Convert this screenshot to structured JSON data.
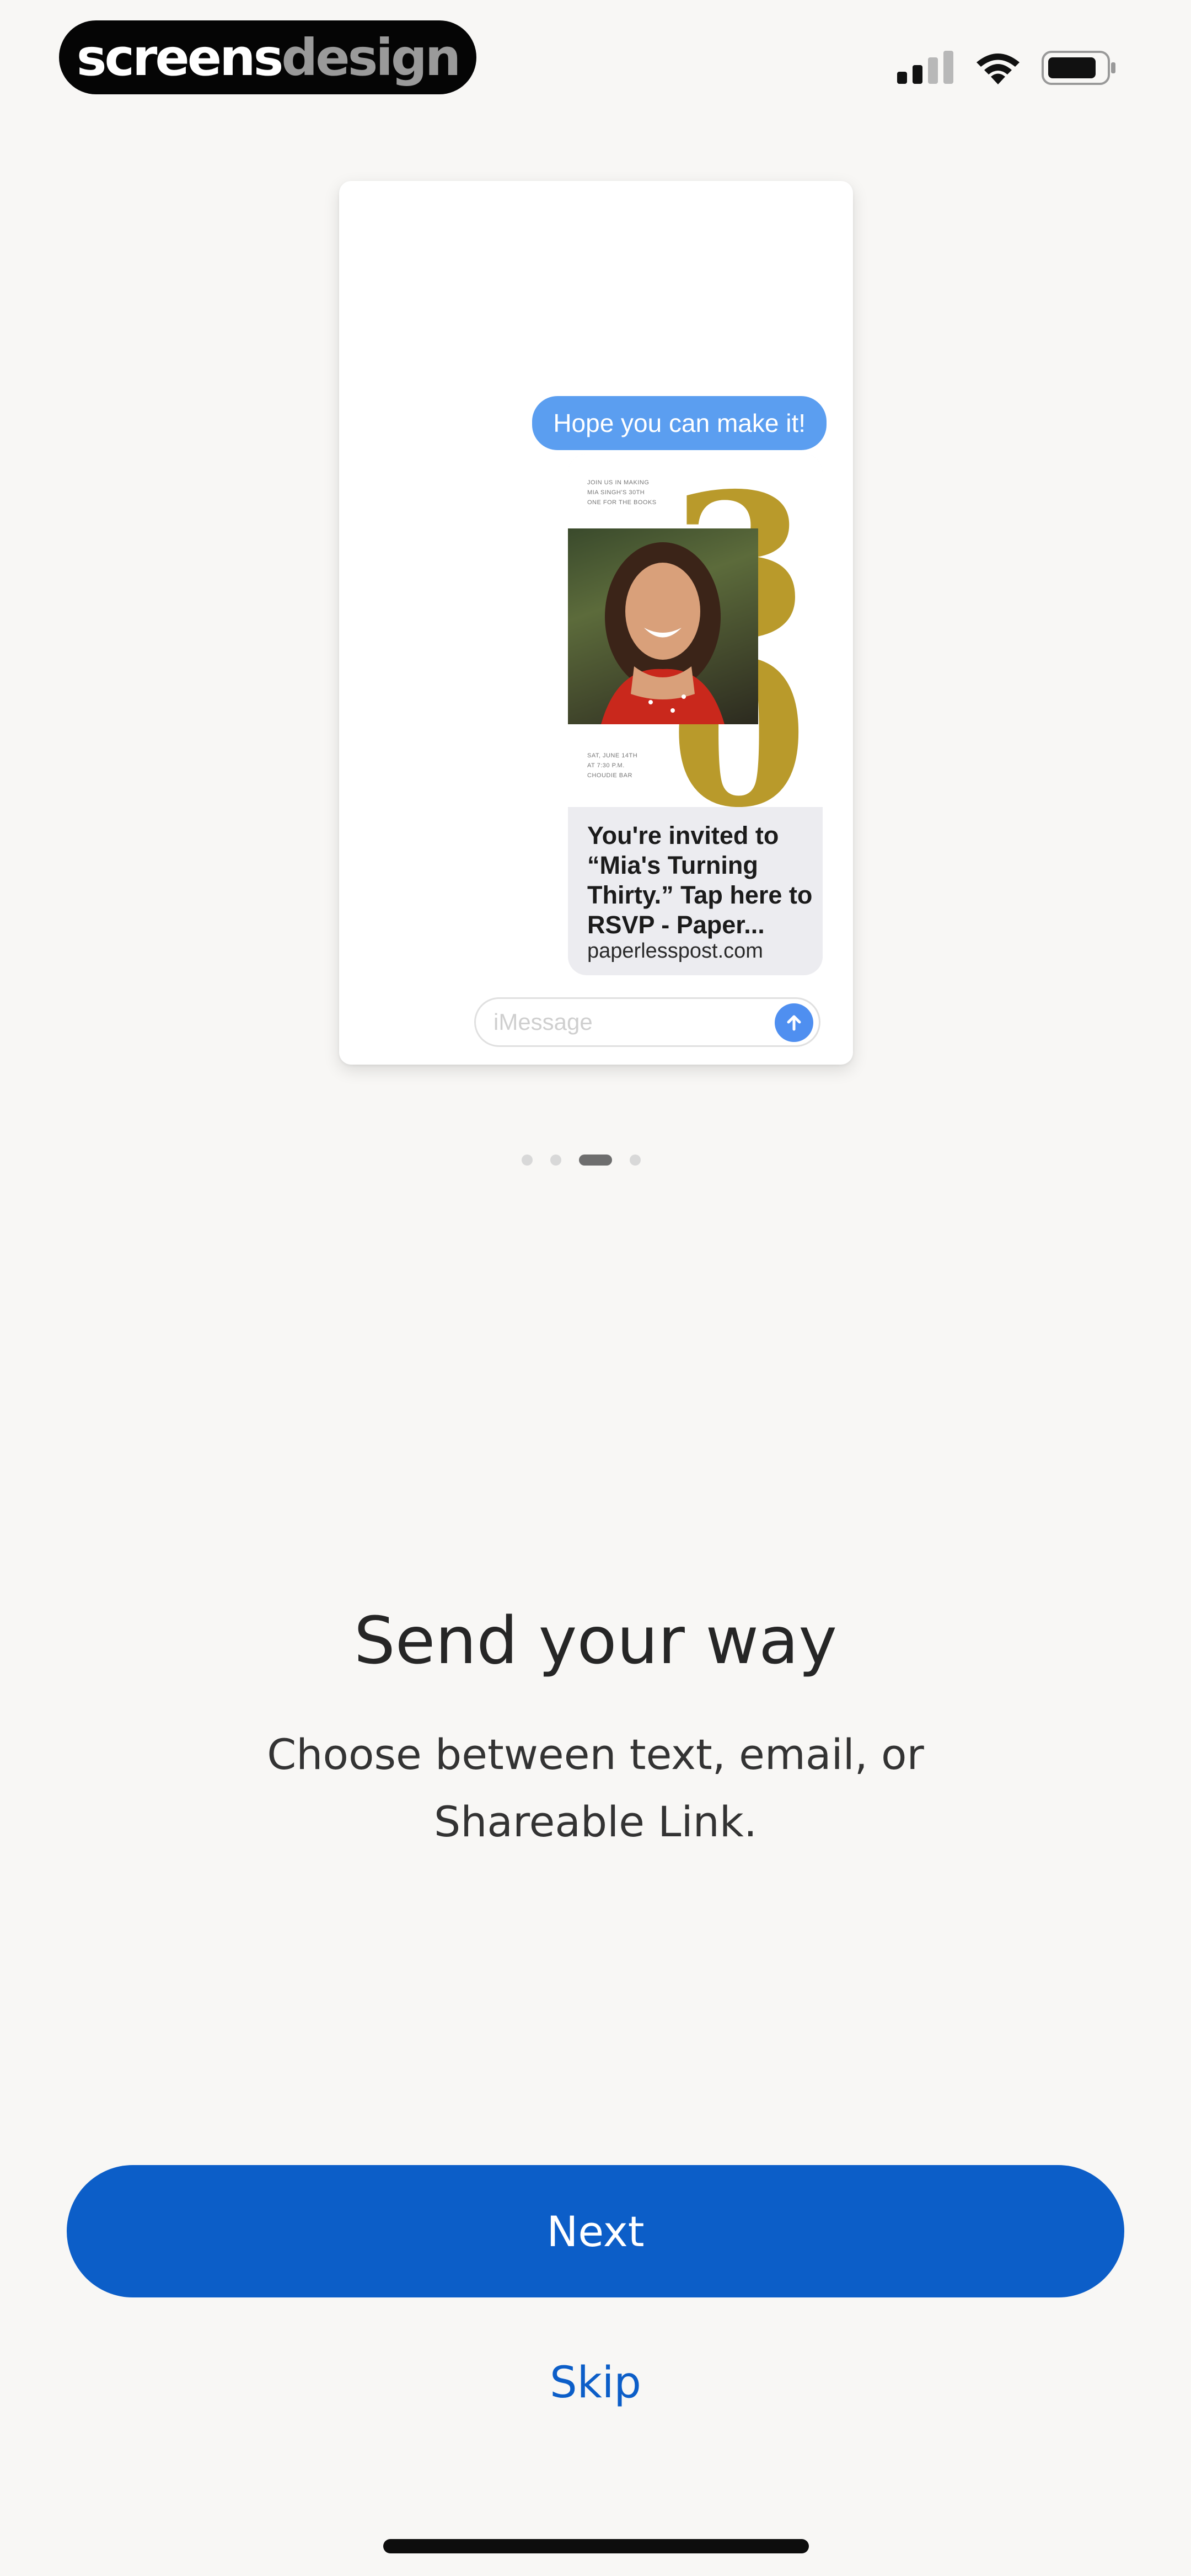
{
  "status_bar": {
    "brand_part1": "screens",
    "brand_part2": "design",
    "icons": [
      "cellular-signal-icon",
      "wifi-icon",
      "battery-icon"
    ]
  },
  "illustration": {
    "message_bubble": "Hope you can make it!",
    "invite_fine_print_top": [
      "JOIN US IN MAKING",
      "MIA SINGH'S 30TH",
      "ONE FOR THE BOOKS"
    ],
    "invite_fine_print_bottom": [
      "SAT, JUNE 14TH",
      "AT 7:30 P.M.",
      "CHOUDIE BAR"
    ],
    "invite_number": "30",
    "invite_text": "You're invited to “Mia's Turning Thirty.” Tap here to RSVP - Paper...",
    "invite_link": "paperlesspost.com",
    "compose_placeholder": "iMessage"
  },
  "pager": {
    "count": 4,
    "active_index": 2
  },
  "onboarding": {
    "title": "Send your way",
    "subtitle": "Choose between text, email, or Shareable Link.",
    "next_label": "Next",
    "skip_label": "Skip"
  },
  "colors": {
    "primary": "#0c5ec8",
    "background": "#f8f7f5",
    "bubble": "#5b9ef0",
    "gold": "#b99a2b"
  }
}
